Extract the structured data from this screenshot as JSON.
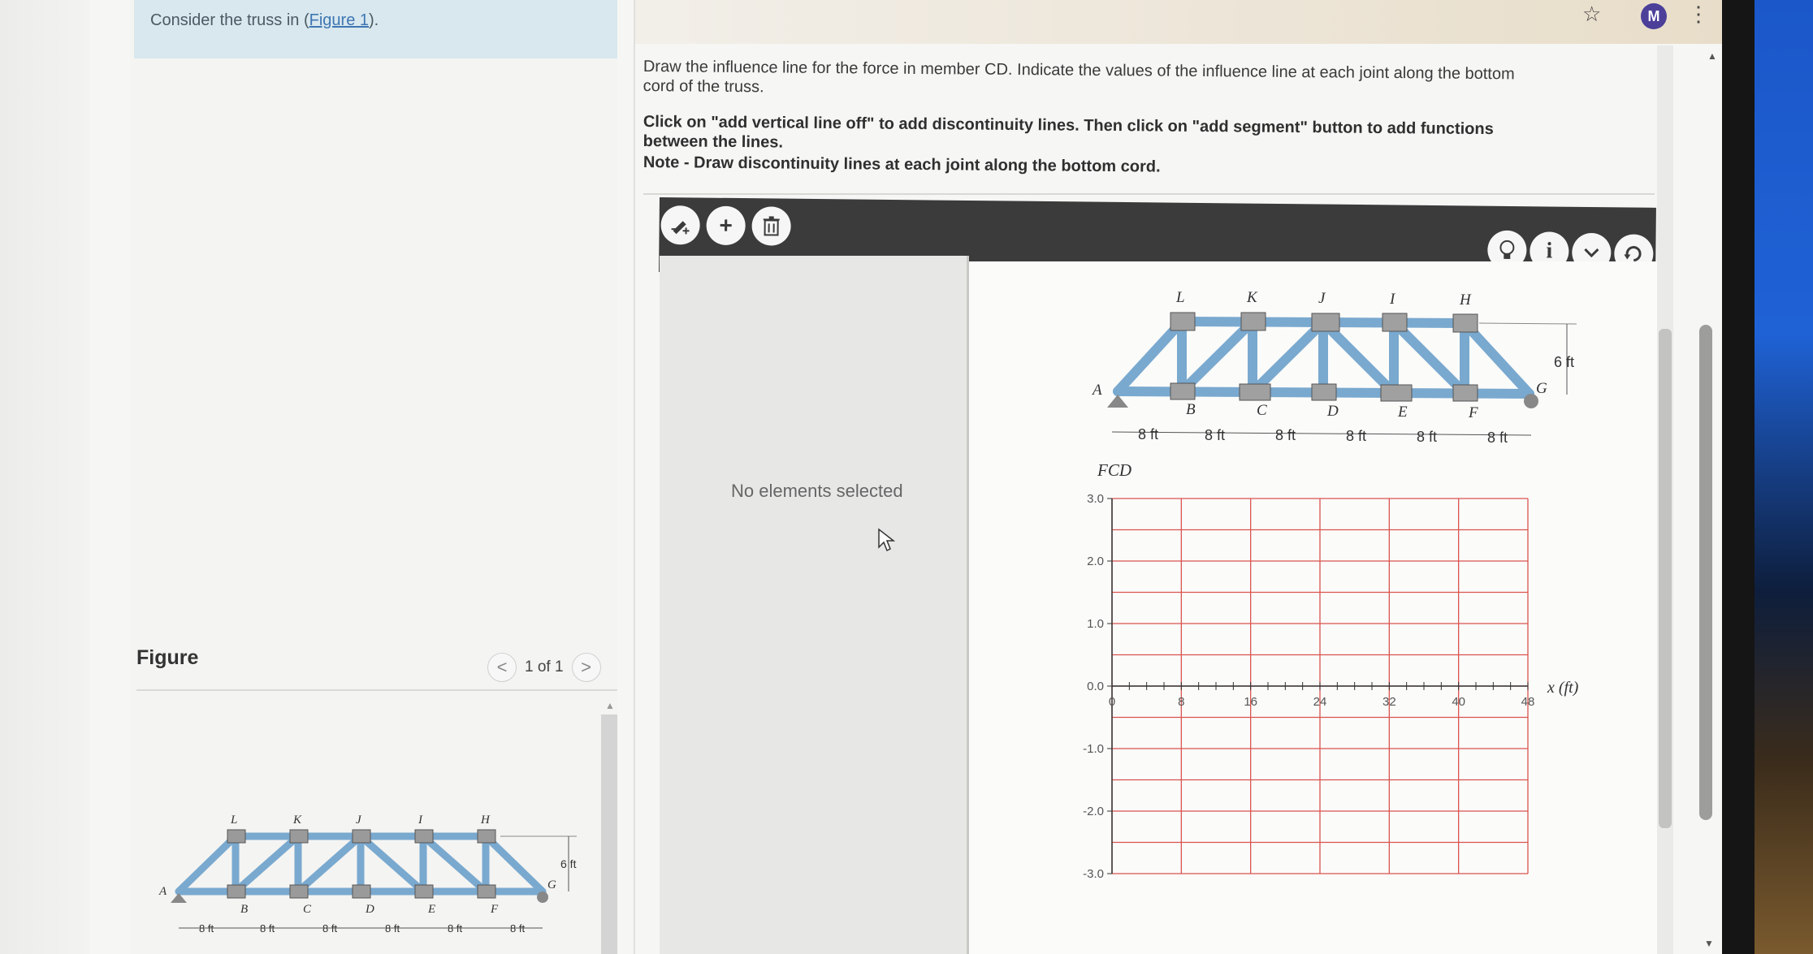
{
  "question": {
    "prefix": "Consider the truss in (",
    "link": "Figure 1",
    "suffix": ")."
  },
  "figure_panel": {
    "title": "Figure",
    "pager": "1 of 1",
    "prev": "<",
    "next": ">"
  },
  "instructions": {
    "line1": "Draw the influence line for the force in member CD. Indicate the values of the influence line at each joint along the bottom cord of the truss.",
    "line2": "Click on \"add vertical line off\" to add discontinuity lines. Then click on \"add segment\" button to add functions between the lines.",
    "line3": "Note - Draw discontinuity lines at each joint along the bottom cord."
  },
  "toolbar": {
    "add_vertical_line": "add vertical line",
    "add_segment": "add segment",
    "delete": "delete",
    "hint": "hint",
    "info": "info",
    "more": "more options",
    "reset": "reset"
  },
  "properties": {
    "empty_text": "No elements selected"
  },
  "truss": {
    "top_labels": [
      "L",
      "K",
      "J",
      "I",
      "H"
    ],
    "bottom_labels": [
      "B",
      "C",
      "D",
      "E",
      "F"
    ],
    "end_left": "A",
    "end_right": "G",
    "height_label": "6 ft",
    "span_label": "8 ft"
  },
  "chart_data": {
    "type": "line",
    "title": "",
    "ylabel": "FCD",
    "xlabel": "x (ft)",
    "xlim": [
      0,
      48
    ],
    "ylim": [
      -3.0,
      3.0
    ],
    "x_ticks": [
      0,
      8,
      16,
      24,
      32,
      40,
      48
    ],
    "y_ticks": [
      "3.0",
      "2.0",
      "1.0",
      "0.0",
      "-1.0",
      "-2.0",
      "-3.0"
    ],
    "series": [],
    "grid": true
  },
  "colors": {
    "truss_member": "#7aa9cf",
    "grid": "#d9534f",
    "toolbar_bg": "#3b3b3b",
    "link": "#3f76b3"
  },
  "browser": {
    "avatar_letter": "M",
    "bookmark_icon": "star-icon",
    "menu_icon": "kebab-icon"
  }
}
